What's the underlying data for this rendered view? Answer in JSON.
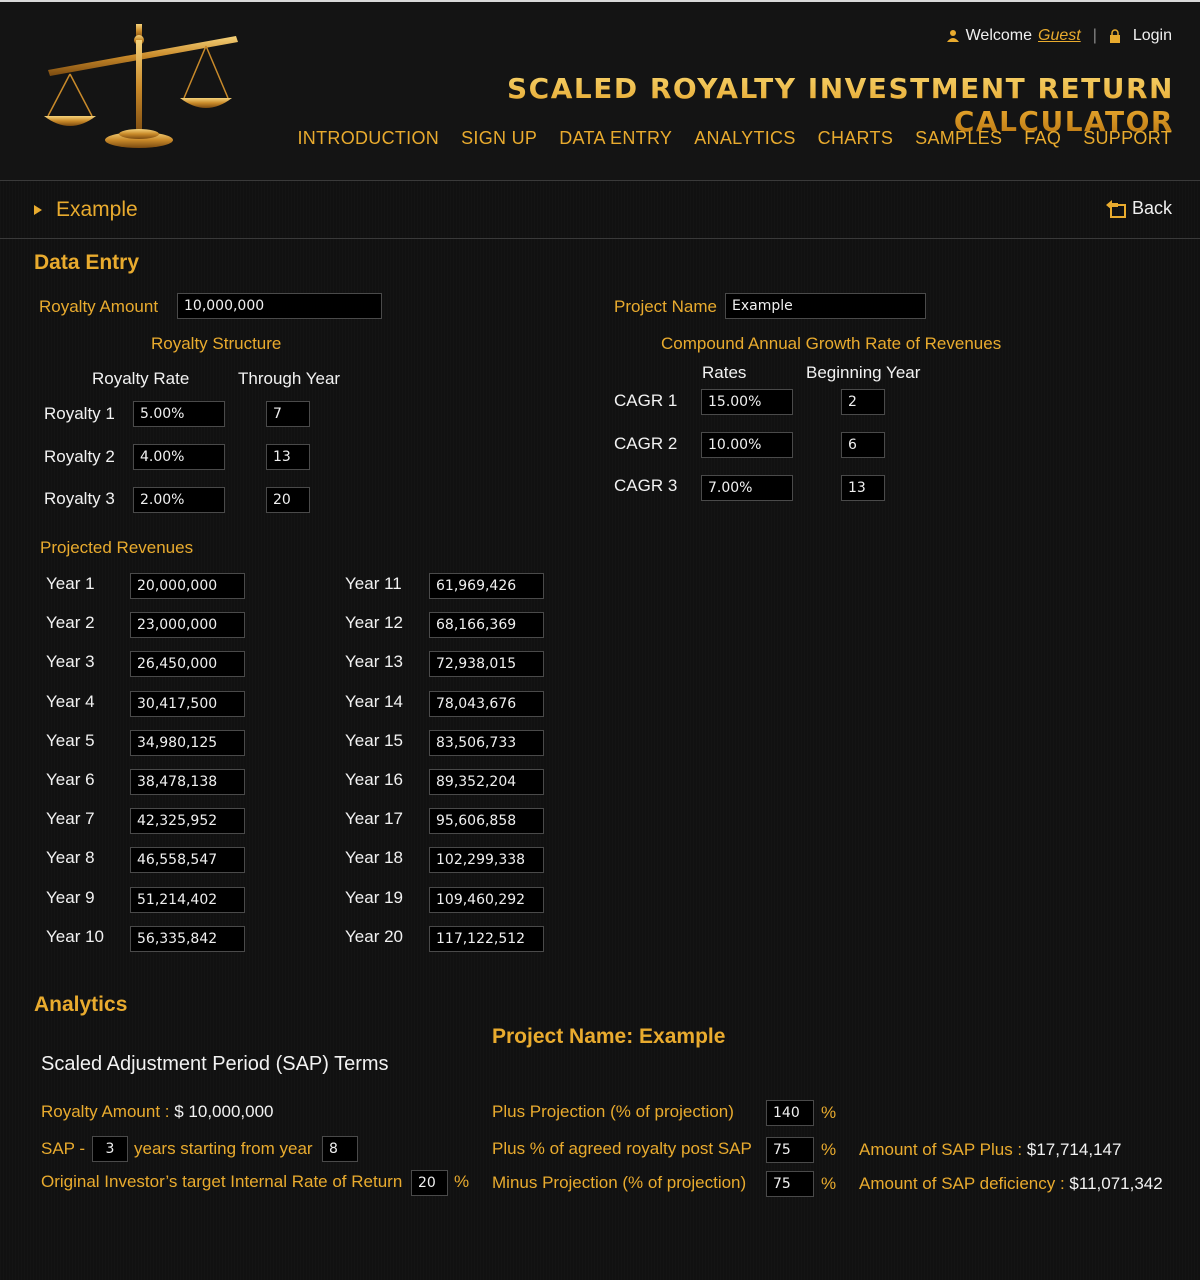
{
  "header": {
    "welcome_label": "Welcome",
    "user": "Guest",
    "login_label": "Login",
    "title": "SCALED ROYALTY INVESTMENT RETURN CALCULATOR",
    "nav": [
      "INTRODUCTION",
      "SIGN UP",
      "DATA ENTRY",
      "ANALYTICS",
      "CHARTS",
      "SAMPLES",
      "FAQ",
      "SUPPORT"
    ]
  },
  "breadcrumb": {
    "page": "Example",
    "back_label": "Back"
  },
  "data_entry": {
    "title": "Data Entry",
    "royalty_amount_label": "Royalty Amount",
    "royalty_amount": "10,000,000",
    "project_name_label": "Project Name",
    "project_name": "Example",
    "royalty_structure_title": "Royalty Structure",
    "royalty_rate_header": "Royalty Rate",
    "through_year_header": "Through Year",
    "royalties": [
      {
        "label": "Royalty 1",
        "rate": "5.00%",
        "year": "7"
      },
      {
        "label": "Royalty 2",
        "rate": "4.00%",
        "year": "13"
      },
      {
        "label": "Royalty 3",
        "rate": "2.00%",
        "year": "20"
      }
    ],
    "cagr_title": "Compound Annual Growth Rate of Revenues",
    "rates_header": "Rates",
    "beginning_year_header": "Beginning Year",
    "cagrs": [
      {
        "label": "CAGR 1",
        "rate": "15.00%",
        "year": "2"
      },
      {
        "label": "CAGR 2",
        "rate": "10.00%",
        "year": "6"
      },
      {
        "label": "CAGR 3",
        "rate": "7.00%",
        "year": "13"
      }
    ],
    "projected_revenues_title": "Projected Revenues",
    "revenues": [
      {
        "label": "Year 1",
        "value": "20,000,000"
      },
      {
        "label": "Year 2",
        "value": "23,000,000"
      },
      {
        "label": "Year 3",
        "value": "26,450,000"
      },
      {
        "label": "Year 4",
        "value": "30,417,500"
      },
      {
        "label": "Year 5",
        "value": "34,980,125"
      },
      {
        "label": "Year 6",
        "value": "38,478,138"
      },
      {
        "label": "Year 7",
        "value": "42,325,952"
      },
      {
        "label": "Year 8",
        "value": "46,558,547"
      },
      {
        "label": "Year 9",
        "value": "51,214,402"
      },
      {
        "label": "Year 10",
        "value": "56,335,842"
      },
      {
        "label": "Year 11",
        "value": "61,969,426"
      },
      {
        "label": "Year 12",
        "value": "68,166,369"
      },
      {
        "label": "Year 13",
        "value": "72,938,015"
      },
      {
        "label": "Year 14",
        "value": "78,043,676"
      },
      {
        "label": "Year 15",
        "value": "83,506,733"
      },
      {
        "label": "Year 16",
        "value": "89,352,204"
      },
      {
        "label": "Year 17",
        "value": "95,606,858"
      },
      {
        "label": "Year 18",
        "value": "102,299,338"
      },
      {
        "label": "Year 19",
        "value": "109,460,292"
      },
      {
        "label": "Year 20",
        "value": "117,122,512"
      }
    ]
  },
  "analytics": {
    "title": "Analytics",
    "project_heading": "Project Name: Example",
    "sap_terms_title": "Scaled Adjustment Period (SAP) Terms",
    "royalty_amount_label": "Royalty Amount : ",
    "royalty_amount_value": "$ 10,000,000",
    "sap_label": "SAP -",
    "sap_years": "3",
    "sap_years_starting_label": "years starting from year",
    "sap_start_year": "8",
    "irr_label": "Original Investor’s target Internal Rate of Return",
    "irr_value": "20",
    "percent": "%",
    "plus_projection_label": "Plus Projection (% of projection)",
    "plus_projection_value": "140",
    "plus_pct_label": "Plus % of agreed royalty post SAP",
    "plus_pct_value": "75",
    "minus_projection_label": "Minus Projection (% of projection)",
    "minus_projection_value": "75",
    "sap_plus_label": "Amount of SAP Plus : ",
    "sap_plus_value": "$17,714,147",
    "sap_deficiency_label": "Amount of SAP deficiency : ",
    "sap_deficiency_value": "$11,071,342"
  },
  "colors": {
    "accent": "#e9ab2e",
    "background": "#111111",
    "input_bg": "#000000"
  },
  "icons": {
    "user": "user-icon",
    "lock": "lock-icon",
    "back": "back-arrow-icon",
    "logo": "scales-of-justice-logo"
  }
}
